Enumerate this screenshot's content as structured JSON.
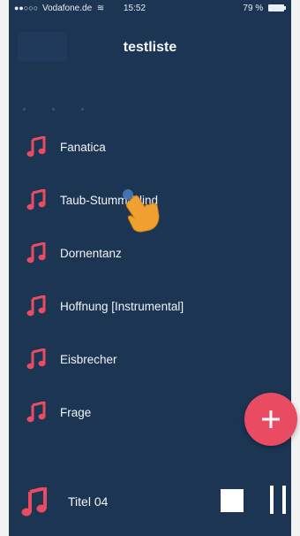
{
  "status_bar": {
    "signal": "●●○○○",
    "carrier": "Vodafone.de",
    "time": "15:52",
    "battery": "79 %"
  },
  "header": {
    "title": "testliste"
  },
  "list": {
    "items": [
      {
        "label": "Fanatica"
      },
      {
        "label": "Taub-Stumm-Blind"
      },
      {
        "label": "Dornentanz"
      },
      {
        "label": "Hoffnung [Instrumental]"
      },
      {
        "label": "Eisbrecher"
      },
      {
        "label": "Frage"
      }
    ]
  },
  "fab": {
    "icon": "plus-icon",
    "color": "#e94b63"
  },
  "player": {
    "title": "Titel 04",
    "stop_icon": "stop-icon",
    "pause_icon": "pause-icon"
  },
  "colors": {
    "background": "#1b3553",
    "accent": "#e94b63",
    "text": "#f1f4f8"
  }
}
